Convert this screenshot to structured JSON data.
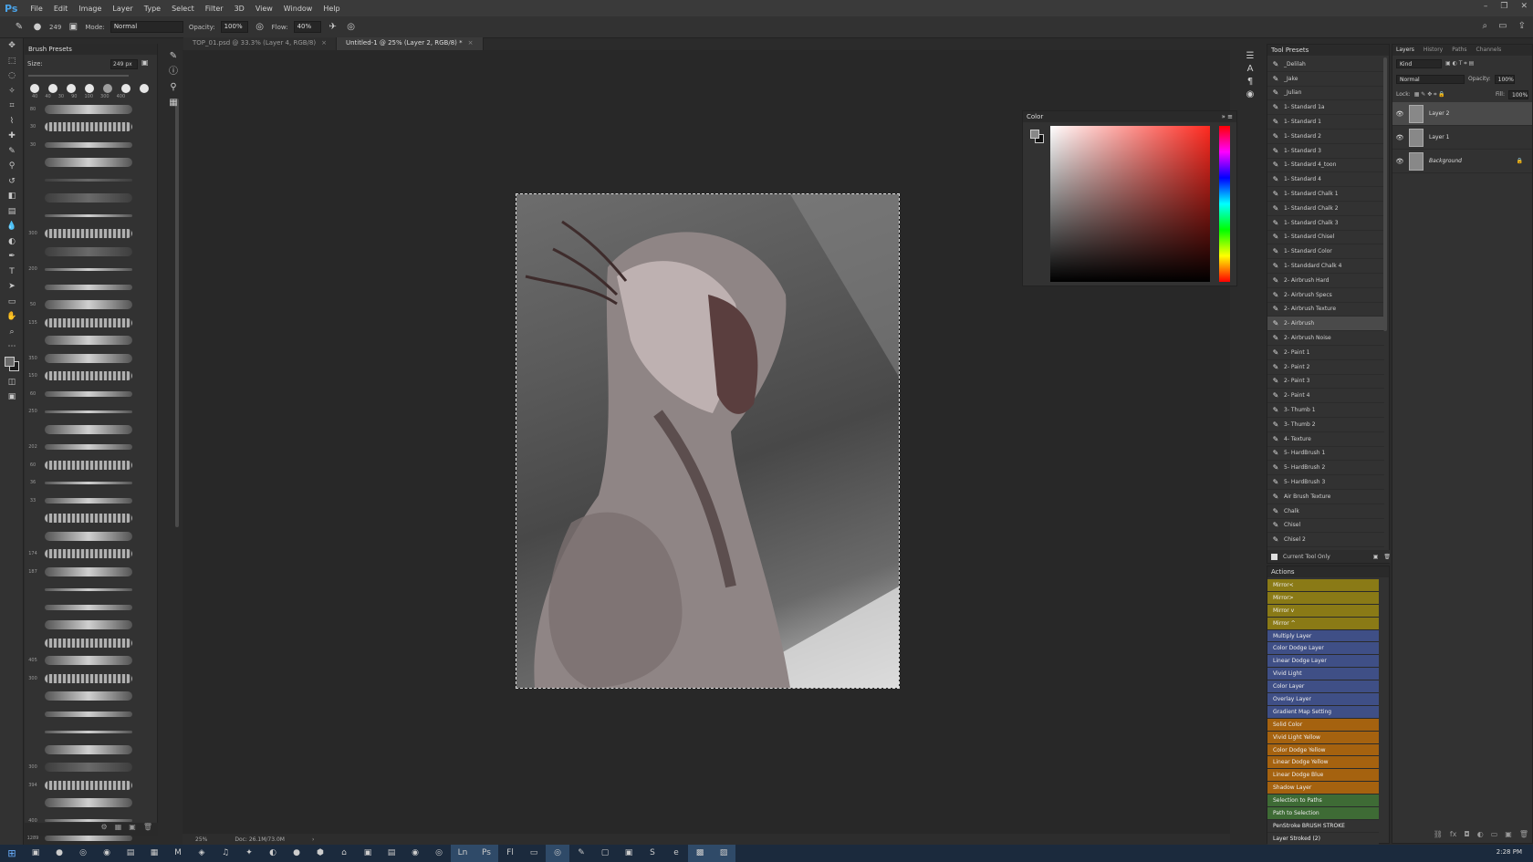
{
  "app": {
    "logo": "Ps"
  },
  "menu": [
    "File",
    "Edit",
    "Image",
    "Layer",
    "Type",
    "Select",
    "Filter",
    "3D",
    "View",
    "Window",
    "Help"
  ],
  "options_bar": {
    "brush_size": "249",
    "mode_label": "Mode:",
    "mode_value": "Normal",
    "opacity_label": "Opacity:",
    "opacity_value": "100%",
    "flow_label": "Flow:",
    "flow_value": "40%"
  },
  "document_tabs": [
    {
      "label": "TOP_01.psd @ 33.3% (Layer 4, RGB/8)",
      "active": false
    },
    {
      "label": "Untitled-1 @ 25% (Layer 2, RGB/8) *",
      "active": true
    }
  ],
  "brush_presets": {
    "title": "Brush Presets",
    "size_label": "Size:",
    "size_value": "249 px",
    "tip_sizes": [
      "40",
      "40",
      "30",
      "90",
      "100",
      "300",
      "400"
    ],
    "stroke_numbers": [
      "80",
      "30",
      "30",
      "",
      "",
      "",
      "",
      "300",
      "",
      "200",
      "",
      "50",
      "135",
      "",
      "350",
      "150",
      "60",
      "250",
      "",
      "202",
      "60",
      "36",
      "33",
      "",
      "",
      "174",
      "187",
      "",
      "",
      "",
      "",
      "405",
      "300",
      "",
      "",
      "",
      "",
      "300",
      "394",
      "",
      "400",
      "1289",
      "",
      "523",
      ""
    ]
  },
  "status_bar": {
    "zoom": "25%",
    "doc_size": "Doc: 26.1M/73.0M"
  },
  "color_panel": {
    "title": "Color"
  },
  "tool_presets": {
    "title": "Tool Presets",
    "items": [
      "_Delilah",
      "_Jake",
      "_Julian",
      "1- Standard 1a",
      "1- Standard 1",
      "1- Standard 2",
      "1- Standard 3",
      "1- Standard 4_toon",
      "1- Standard 4",
      "1- Standard Chalk 1",
      "1- Standard Chalk 2",
      "1- Standard Chalk 3",
      "1- Standard Chisel",
      "1- Standard Color",
      "1- Standdard Chalk 4",
      "2- Airbrush Hard",
      "2- Airbrush Specs",
      "2- Airbrush Texture",
      "2- Airbrush",
      "2- Airbrush Noise",
      "2- Paint 1",
      "2- Paint 2",
      "2- Paint 3",
      "2- Paint 4",
      "3- Thumb 1",
      "3- Thumb 2",
      "4- Texture",
      "5- HardBrush 1",
      "5- HardBrush 2",
      "5- HardBrush 3",
      "Air Brush Texture",
      "Chalk",
      "Chisel",
      "Chisel 2"
    ],
    "selected": "2- Airbrush",
    "current_tool_only": "Current Tool Only"
  },
  "actions": {
    "title": "Actions",
    "items": [
      {
        "label": "Mirror<",
        "color": "#8a7a16"
      },
      {
        "label": "Mirror>",
        "color": "#8a7a16"
      },
      {
        "label": "Mirror v",
        "color": "#8a7a16"
      },
      {
        "label": "Mirror ^",
        "color": "#8a7a16"
      },
      {
        "label": "Multiply Layer",
        "color": "#3f4f86"
      },
      {
        "label": "Color Dodge Layer",
        "color": "#3f4f86"
      },
      {
        "label": "Linear Dodge Layer",
        "color": "#3f4f86"
      },
      {
        "label": "Vivid Light",
        "color": "#3f4f86"
      },
      {
        "label": "Color Layer",
        "color": "#3f4f86"
      },
      {
        "label": "Overlay Layer",
        "color": "#3f4f86"
      },
      {
        "label": "Gradient Map Setting",
        "color": "#3f4f86"
      },
      {
        "label": "Solid Color",
        "color": "#a5620f"
      },
      {
        "label": "Vivid Light Yellow",
        "color": "#a5620f"
      },
      {
        "label": "Color Dodge Yellow",
        "color": "#a5620f"
      },
      {
        "label": "Linear Dodge Yellow",
        "color": "#a5620f"
      },
      {
        "label": "Linear Dodge Blue",
        "color": "#a5620f"
      },
      {
        "label": "Shadow Layer",
        "color": "#a5620f"
      },
      {
        "label": "Selection to Paths",
        "color": "#3e6b35"
      },
      {
        "label": "Path to Selection",
        "color": "#3e6b35"
      },
      {
        "label": "PenStroke BRUSH STROKE",
        "color": "#323232"
      },
      {
        "label": "Layer Stroked (2)",
        "color": "#323232"
      }
    ]
  },
  "layers": {
    "tabs": [
      "Layers",
      "History",
      "Paths",
      "Channels"
    ],
    "kind": "Kind",
    "blend_mode": "Normal",
    "opacity_label": "Opacity:",
    "opacity_value": "100%",
    "lock_label": "Lock:",
    "fill_label": "Fill:",
    "fill_value": "100%",
    "items": [
      {
        "name": "Layer 2",
        "active": true
      },
      {
        "name": "Layer 1",
        "active": false
      },
      {
        "name": "Background",
        "active": false
      }
    ]
  },
  "taskbar": {
    "time": "2:28 PM"
  }
}
